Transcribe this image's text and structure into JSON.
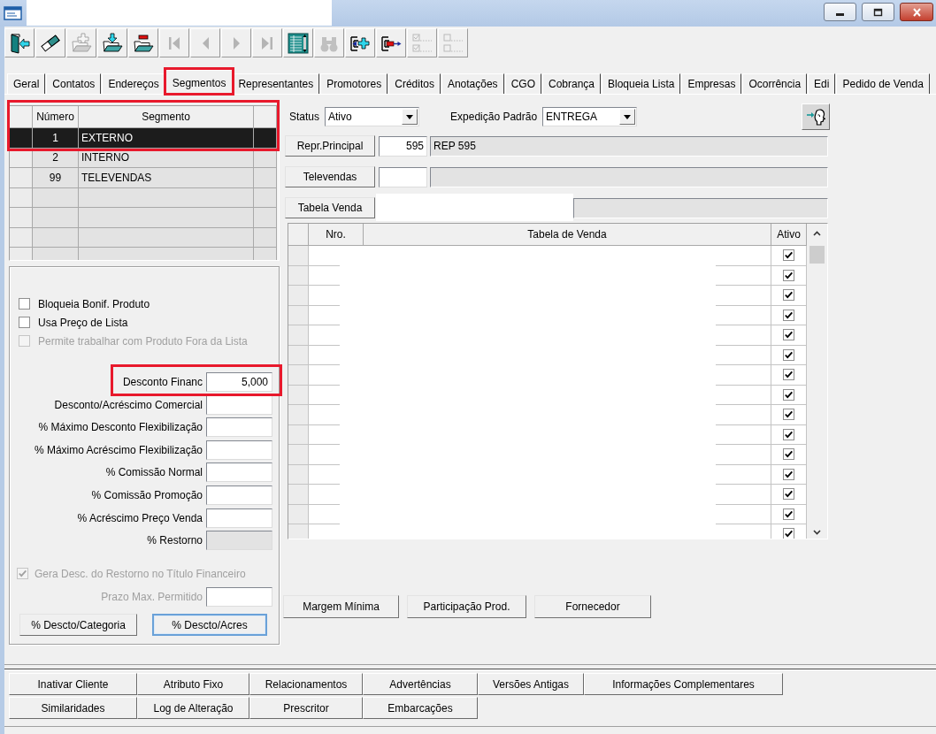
{
  "toolbar": [
    {
      "kind": "exit",
      "disabled": false
    },
    {
      "kind": "eraser",
      "disabled": false
    },
    {
      "kind": "add-folder",
      "disabled": true
    },
    {
      "kind": "folder-in",
      "disabled": false
    },
    {
      "kind": "folder-remove",
      "disabled": false
    },
    {
      "kind": "first",
      "disabled": true
    },
    {
      "kind": "prev",
      "disabled": true
    },
    {
      "kind": "next",
      "disabled": true
    },
    {
      "kind": "last",
      "disabled": true
    },
    {
      "kind": "grid",
      "disabled": false
    },
    {
      "kind": "binoculars",
      "disabled": true
    },
    {
      "kind": "insert",
      "disabled": false
    },
    {
      "kind": "remove",
      "disabled": false
    },
    {
      "kind": "checks",
      "disabled": true
    },
    {
      "kind": "unchecks",
      "disabled": true
    }
  ],
  "tabs": [
    {
      "label": "Geral",
      "selected": false,
      "highlighted": false
    },
    {
      "label": "Contatos",
      "selected": false,
      "highlighted": false
    },
    {
      "label": "Endereços",
      "selected": false,
      "highlighted": false
    },
    {
      "label": "Segmentos",
      "selected": true,
      "highlighted": true
    },
    {
      "label": "Representantes",
      "selected": false,
      "highlighted": false
    },
    {
      "label": "Promotores",
      "selected": false,
      "highlighted": false
    },
    {
      "label": "Créditos",
      "selected": false,
      "highlighted": false
    },
    {
      "label": "Anotações",
      "selected": false,
      "highlighted": false
    },
    {
      "label": "CGO",
      "selected": false,
      "highlighted": false
    },
    {
      "label": "Cobrança",
      "selected": false,
      "highlighted": false
    },
    {
      "label": "Bloqueia Lista",
      "selected": false,
      "highlighted": false
    },
    {
      "label": "Empresas",
      "selected": false,
      "highlighted": false
    },
    {
      "label": "Ocorrência",
      "selected": false,
      "highlighted": false
    },
    {
      "label": "Edi",
      "selected": false,
      "highlighted": false
    },
    {
      "label": "Pedido de Venda",
      "selected": false,
      "highlighted": false
    }
  ],
  "segments": {
    "columns": [
      "Número",
      "Segmento"
    ],
    "rows": [
      {
        "number": "1",
        "name": "EXTERNO",
        "selected": true,
        "highlighted": true
      },
      {
        "number": "2",
        "name": "INTERNO",
        "selected": false,
        "highlighted": false
      },
      {
        "number": "99",
        "name": "TELEVENDAS",
        "selected": false,
        "highlighted": false
      }
    ]
  },
  "options": {
    "checkboxes": [
      {
        "label": "Bloqueia Bonif. Produto",
        "checked": false,
        "disabled": false
      },
      {
        "label": "Usa Preço de Lista",
        "checked": false,
        "disabled": false
      },
      {
        "label": "Permite trabalhar com Produto Fora da Lista",
        "checked": false,
        "disabled": true
      }
    ],
    "fields": [
      {
        "label": "Desconto Financ",
        "value": "5,000",
        "readonly": false,
        "highlighted": true
      },
      {
        "label": "Desconto/Acréscimo Comercial",
        "readonly": false,
        "highlighted": false
      },
      {
        "label": "% Máximo Desconto Flexibilização",
        "readonly": false,
        "highlighted": false
      },
      {
        "label": "% Máximo Acréscimo Flexibilização",
        "readonly": false,
        "highlighted": false
      },
      {
        "label": "% Comissão Normal",
        "readonly": false,
        "highlighted": false
      },
      {
        "label": "% Comissão Promoção",
        "readonly": false,
        "highlighted": false
      },
      {
        "label": "% Acréscimo Preço Venda",
        "readonly": false,
        "highlighted": false
      },
      {
        "label": "% Restorno",
        "readonly": true,
        "highlighted": false
      }
    ],
    "restorno_checkbox": {
      "label": "Gera Desc. do Restorno no Título Financeiro",
      "checked": true,
      "disabled": true
    },
    "prazo_field": {
      "label": "Prazo Max. Permitido",
      "disabled": true
    },
    "buttons": [
      {
        "label": "% Descto/Categoria",
        "focused": false
      },
      {
        "label": "% Descto/Acres",
        "focused": true
      }
    ]
  },
  "details": {
    "status": {
      "label": "Status",
      "value": "Ativo"
    },
    "expedicao": {
      "label": "Expedição Padrão",
      "value": "ENTREGA"
    },
    "lookups": [
      {
        "button": "Repr.Principal",
        "code": "595",
        "name": "REP 595",
        "redacted": false
      },
      {
        "button": "Televendas",
        "redacted": false
      },
      {
        "button": "Tabela Venda",
        "redacted": true
      }
    ],
    "price_tables": {
      "columns": [
        "Nro.",
        "Tabela de Venda",
        "Ativo"
      ],
      "rows": [
        {
          "active": true
        },
        {
          "active": true
        },
        {
          "active": true
        },
        {
          "active": true
        },
        {
          "active": true
        },
        {
          "active": true
        },
        {
          "active": true
        },
        {
          "active": true
        },
        {
          "active": true
        },
        {
          "active": true
        },
        {
          "active": true
        },
        {
          "active": true
        },
        {
          "active": true
        },
        {
          "active": true
        },
        {
          "active": true
        }
      ]
    },
    "actions": [
      "Margem Mínima",
      "Participação Prod.",
      "Fornecedor"
    ]
  },
  "bottom_buttons": [
    [
      "Inativar Cliente",
      "Atributo Fixo",
      "Relacionamentos",
      "Advertências",
      "Versões Antigas",
      "Informações Complementares"
    ],
    [
      "Similaridades",
      "Log de Alteração",
      "Prescritor",
      "Embarcações"
    ]
  ]
}
